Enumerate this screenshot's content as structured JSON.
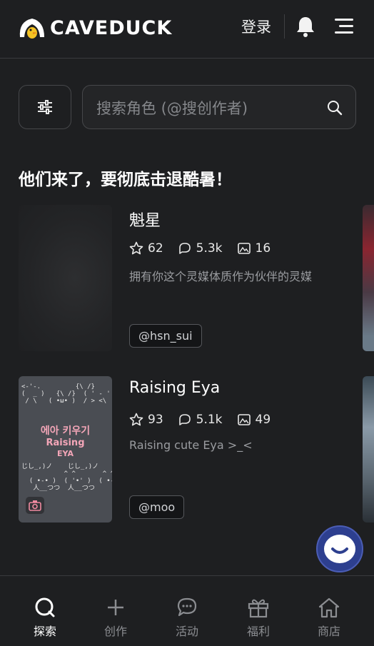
{
  "header": {
    "brand": "CAVEDUCK",
    "login_label": "登录",
    "icons": [
      "bell-icon",
      "menu-icon"
    ]
  },
  "search": {
    "placeholder": "搜索角色 (@搜创作者)"
  },
  "section": {
    "title": "他们来了，要彻底击退酷暑！"
  },
  "cards": [
    {
      "name": "魁星",
      "stars": "62",
      "chats": "5.3k",
      "images": "16",
      "description": "拥有你这个灵媒体质作为伙伴的灵媒",
      "creator": "@hsn_sui"
    },
    {
      "name": "Raising Eya",
      "stars": "93",
      "chats": "5.1k",
      "images": "49",
      "description": "Raising cute Eya >_<",
      "creator": "@moo",
      "thumb_text": [
        "에아 키우기",
        "Raising",
        "EYA"
      ]
    }
  ],
  "tabs": [
    {
      "label": "探索",
      "icon": "explore-icon",
      "active": true
    },
    {
      "label": "创作",
      "icon": "plus-icon",
      "active": false
    },
    {
      "label": "活动",
      "icon": "chat-bubble-icon",
      "active": false
    },
    {
      "label": "福利",
      "icon": "gift-icon",
      "active": false
    },
    {
      "label": "商店",
      "icon": "home-icon",
      "active": false
    }
  ],
  "colors": {
    "background": "#1e1f21",
    "accent_fab": "#2d3f8f",
    "muted_text": "#9a9ca0"
  }
}
